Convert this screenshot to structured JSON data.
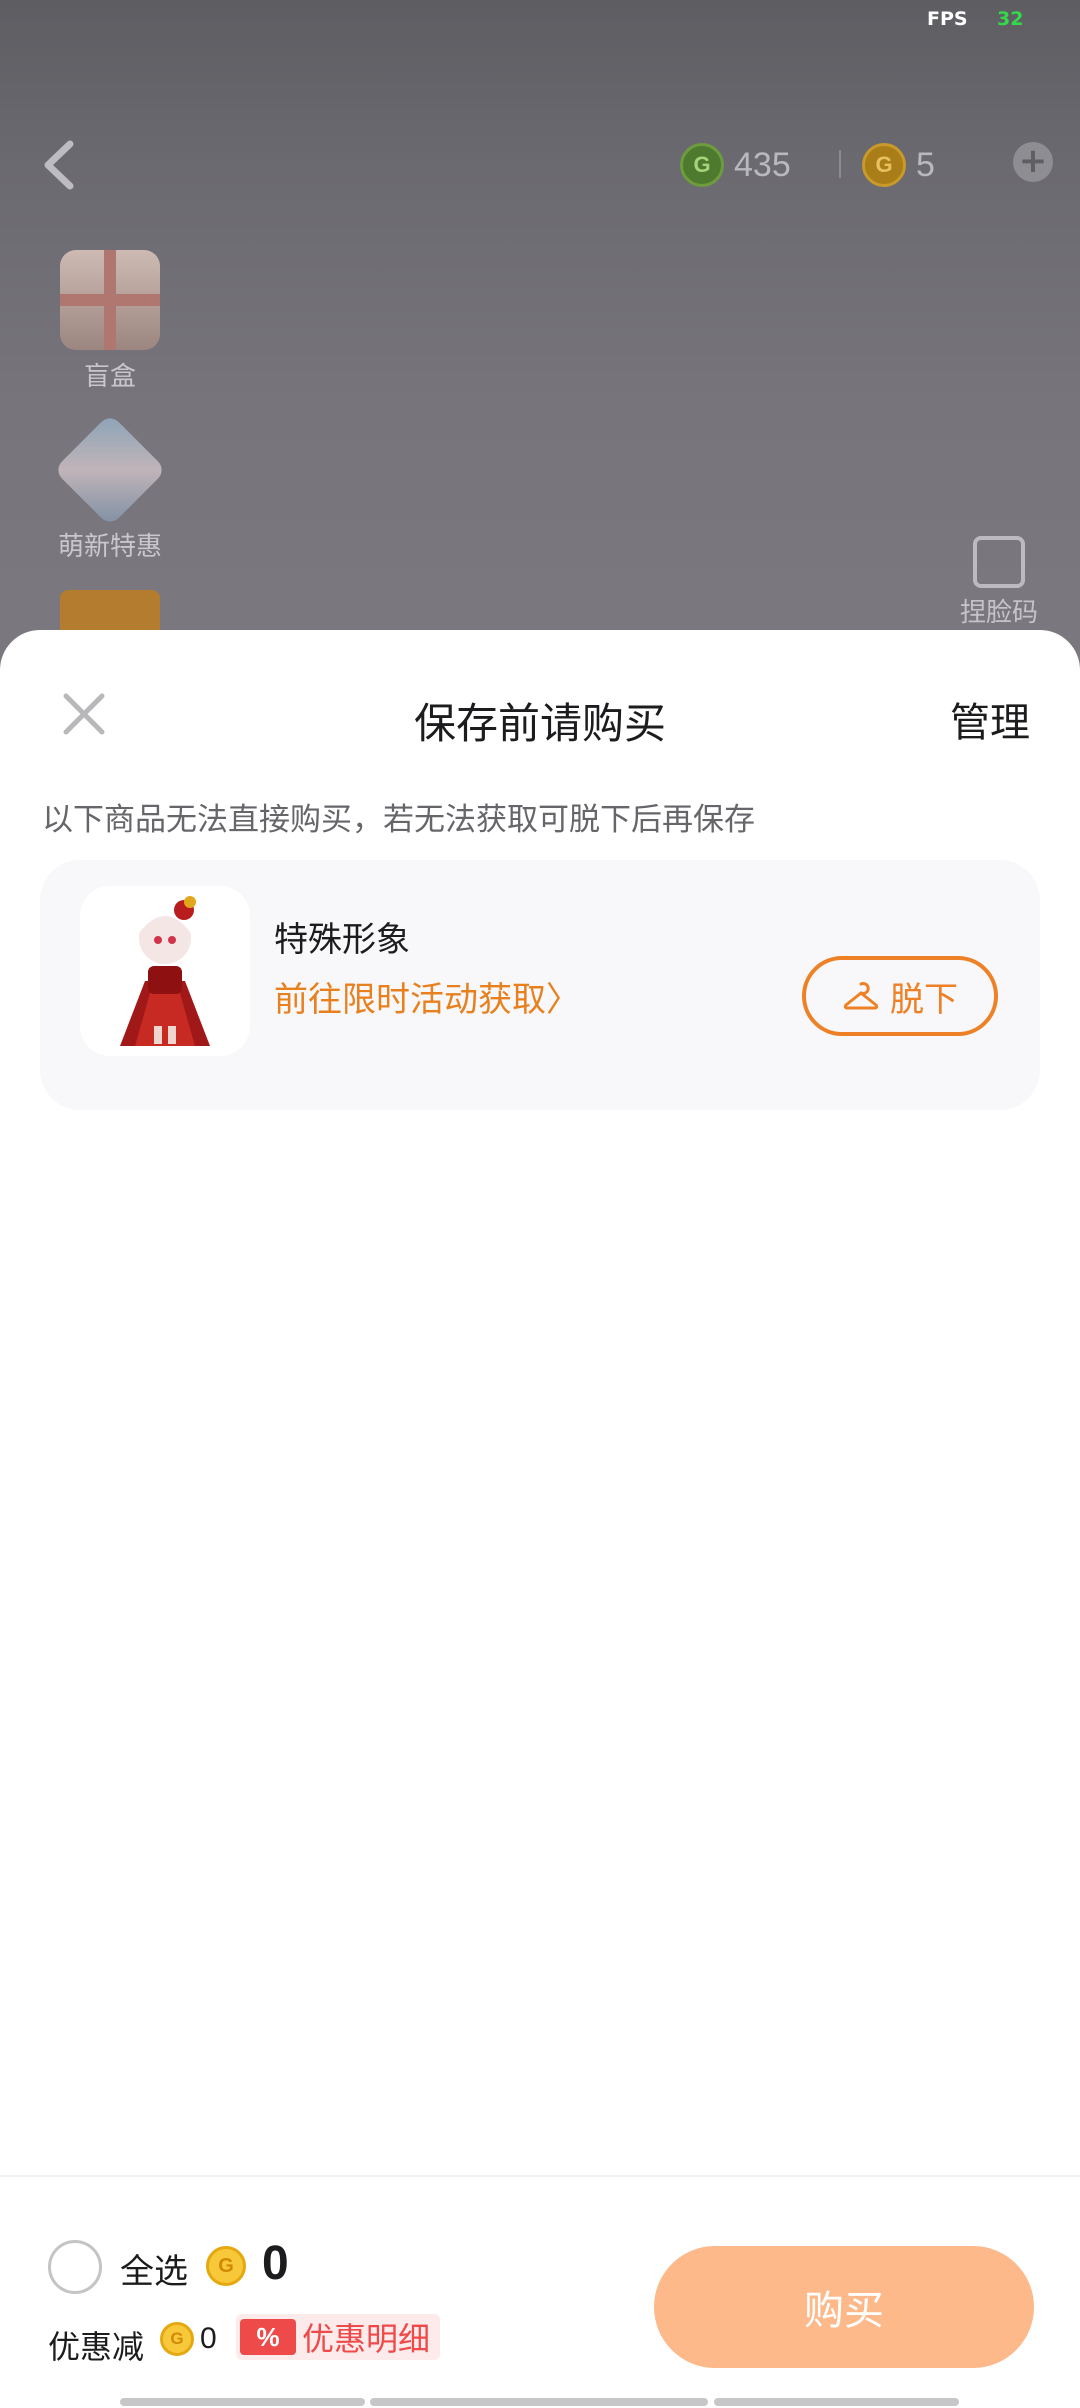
{
  "status": {
    "fps_label": "FPS",
    "fps_value": "32"
  },
  "top_bar": {
    "green_coin_icon": "g-coin-green-icon",
    "green_coin_value": "435",
    "gold_coin_icon": "g-coin-gold-icon",
    "gold_coin_value": "5"
  },
  "side_menu": [
    {
      "label": "盲盒",
      "icon": "gift-box-icon"
    },
    {
      "label": "萌新特惠",
      "icon": "newbie-offer-icon"
    }
  ],
  "face_code": {
    "label": "捏脸码",
    "icon": "edit-face-icon"
  },
  "sheet": {
    "title": "保存前请购买",
    "manage_label": "管理",
    "hint": "以下商品无法直接购买，若无法获取可脱下后再保存",
    "items": [
      {
        "name": "特殊形象",
        "link_text": "前往限时活动获取〉",
        "action_label": "脱下",
        "action_icon": "hanger-icon"
      }
    ]
  },
  "footer": {
    "select_all_label": "全选",
    "total_value": "0",
    "discount_label": "优惠减",
    "discount_value": "0",
    "discount_badge": "%",
    "discount_detail_label": "优惠明细",
    "buy_label": "购买"
  },
  "colors": {
    "accent_orange": "#ee8126",
    "buy_button": "#fdb98a",
    "discount_red": "#ef4a4a",
    "coin_gold": "#f6c83a"
  }
}
